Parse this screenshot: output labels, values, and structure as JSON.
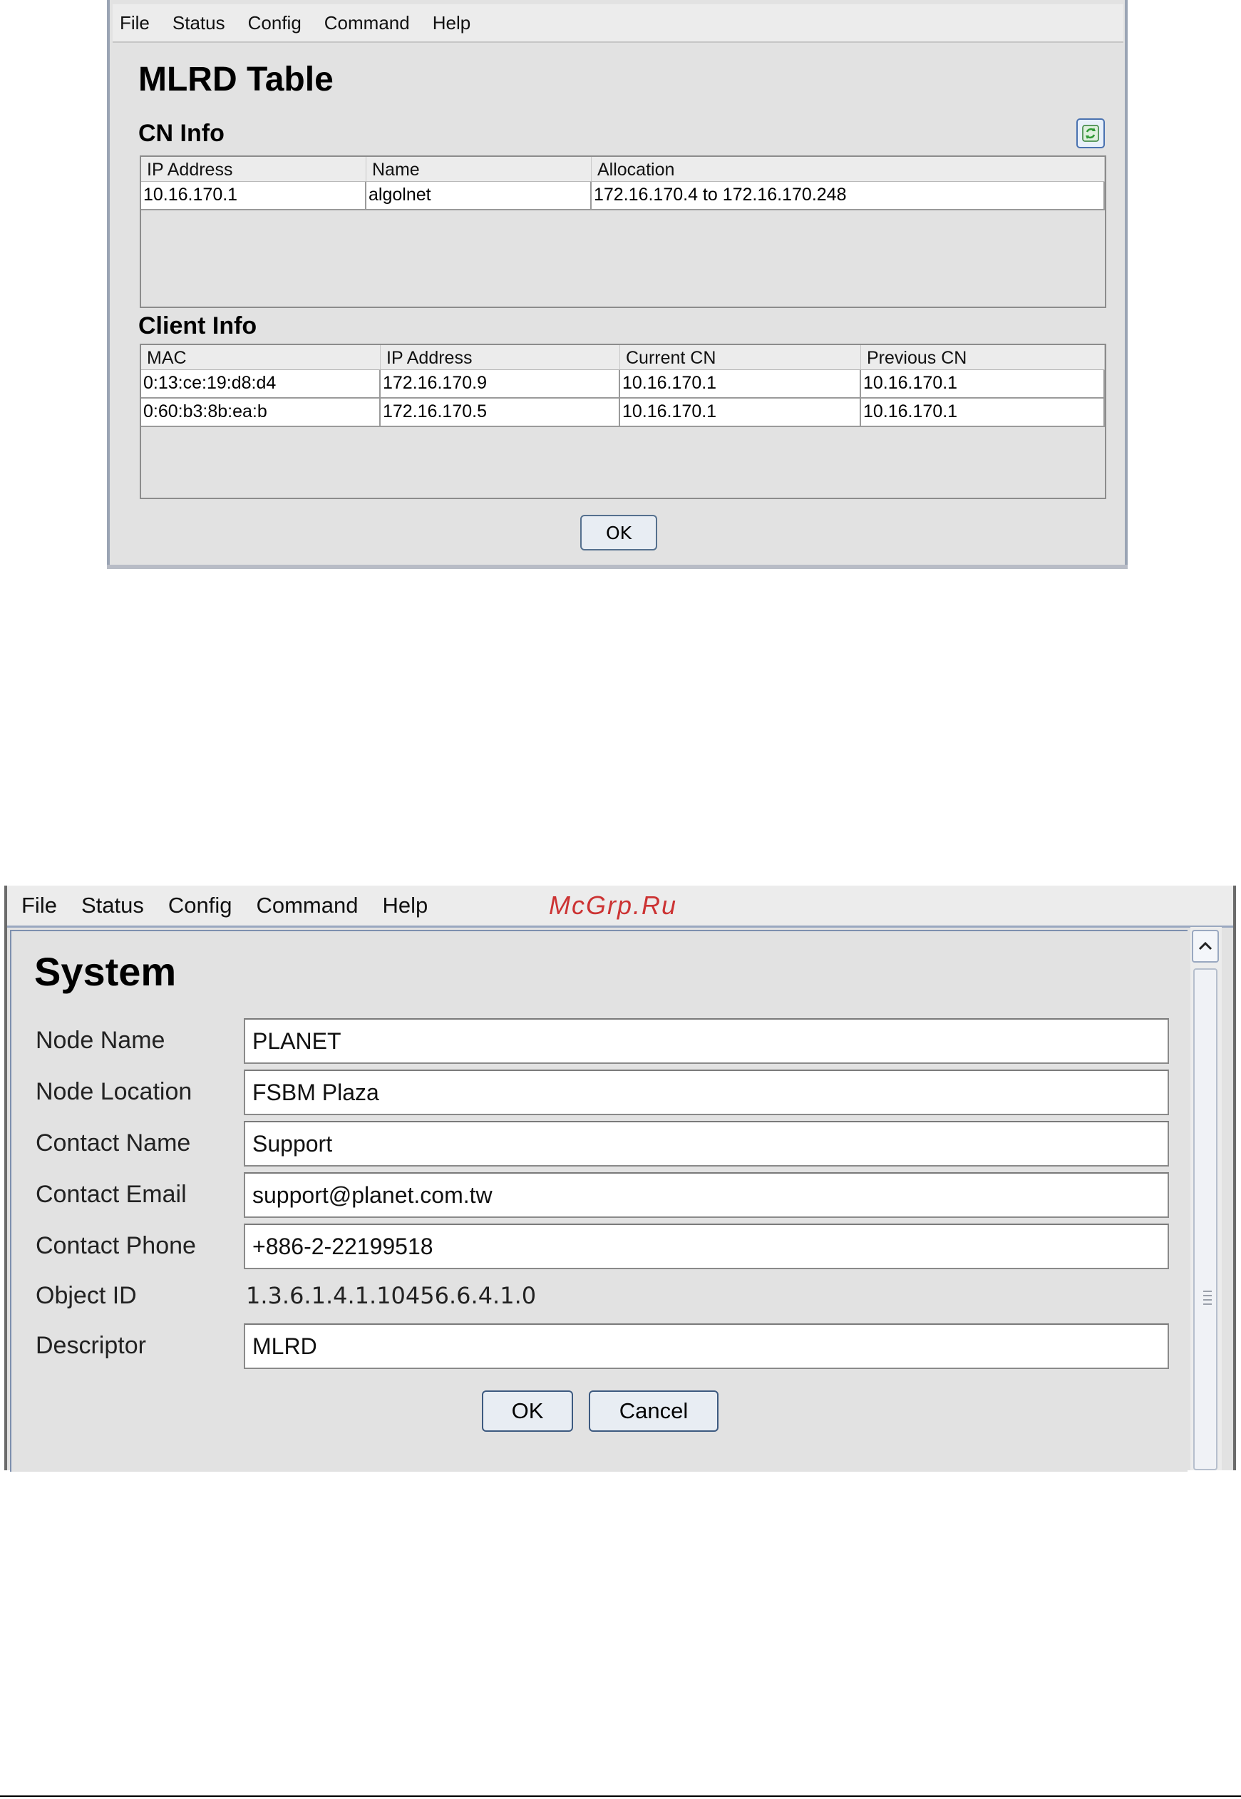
{
  "window1": {
    "menu": [
      "File",
      "Status",
      "Config",
      "Command",
      "Help"
    ],
    "title": "MLRD Table",
    "cn_info": {
      "heading": "CN Info",
      "columns": [
        "IP Address",
        "Name",
        "Allocation"
      ],
      "rows": [
        [
          "10.16.170.1",
          "algolnet",
          "172.16.170.4 to 172.16.170.248"
        ]
      ]
    },
    "client_info": {
      "heading": "Client Info",
      "columns": [
        "MAC",
        "IP Address",
        "Current CN",
        "Previous CN"
      ],
      "rows": [
        [
          "0:13:ce:19:d8:d4",
          "172.16.170.9",
          "10.16.170.1",
          "10.16.170.1"
        ],
        [
          "0:60:b3:8b:ea:b",
          "172.16.170.5",
          "10.16.170.1",
          "10.16.170.1"
        ]
      ]
    },
    "ok_label": "OK",
    "refresh_icon": "refresh-icon"
  },
  "watermark": "McGrp.Ru",
  "window2": {
    "menu": [
      "File",
      "Status",
      "Config",
      "Command",
      "Help"
    ],
    "title": "System",
    "fields": {
      "node_name": {
        "label": "Node Name",
        "value": "PLANET"
      },
      "node_location": {
        "label": "Node Location",
        "value": "FSBM Plaza"
      },
      "contact_name": {
        "label": "Contact Name",
        "value": "Support"
      },
      "contact_email": {
        "label": "Contact Email",
        "value": "support@planet.com.tw"
      },
      "contact_phone": {
        "label": "Contact Phone",
        "value": "+886-2-22199518"
      },
      "object_id": {
        "label": "Object ID",
        "value": "1.3.6.1.4.1.10456.6.4.1.0"
      },
      "descriptor": {
        "label": "Descriptor",
        "value": "MLRD"
      }
    },
    "ok_label": "OK",
    "cancel_label": "Cancel"
  },
  "colors": {
    "window_bg": "#e2e2e2",
    "menubar_bg": "#ececec",
    "button_border": "#3d5a80",
    "watermark": "#cc3333"
  }
}
